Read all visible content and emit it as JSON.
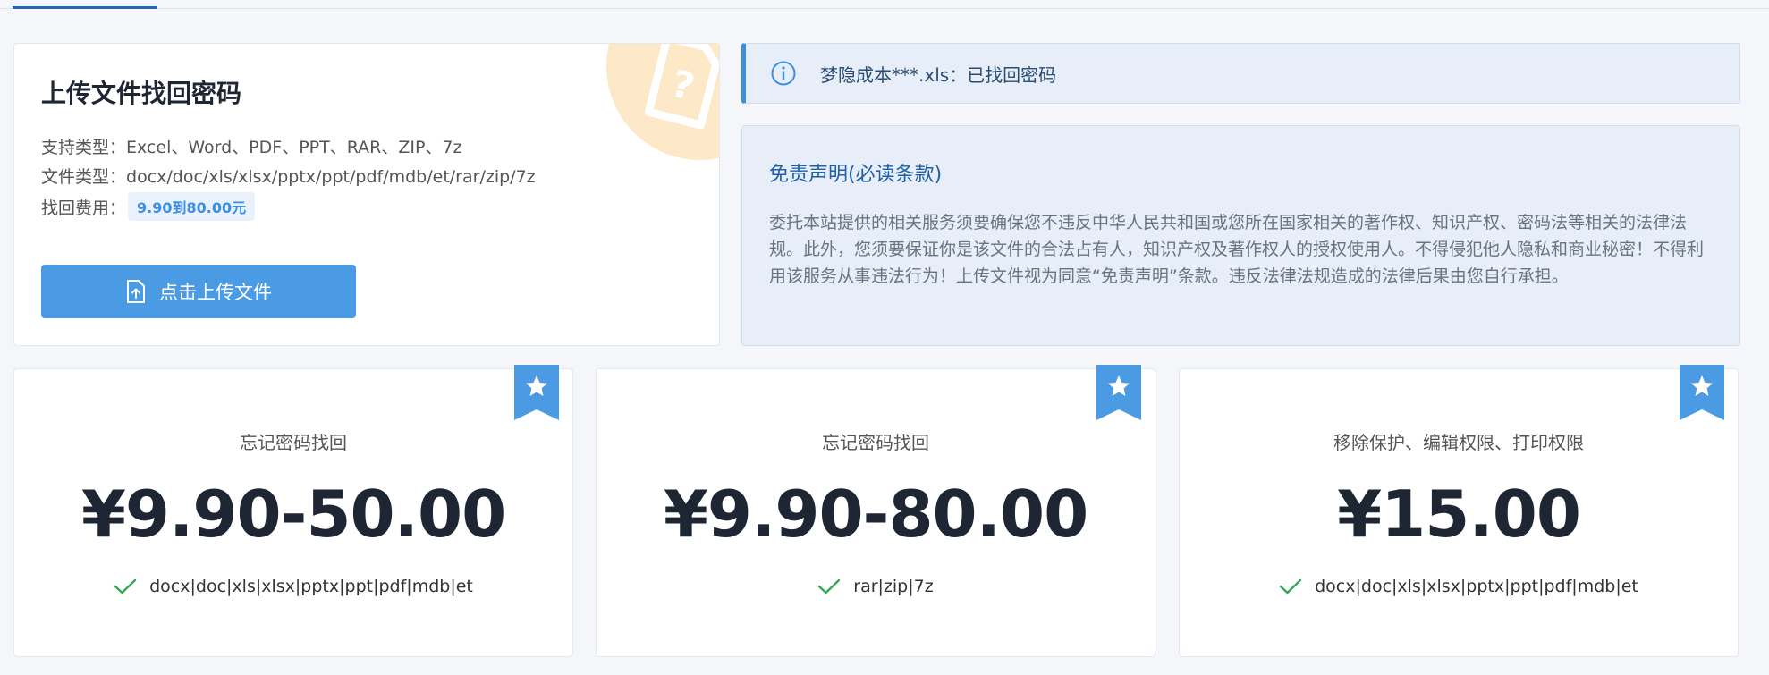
{
  "upload": {
    "title": "上传文件找回密码",
    "support_label": "支持类型：",
    "support_value": "Excel、Word、PDF、PPT、RAR、ZIP、7z",
    "filetype_label": "文件类型：",
    "filetype_value": "docx/doc/xls/xlsx/pptx/ppt/pdf/mdb/et/rar/zip/7z",
    "fee_label": "找回费用：",
    "fee_value": "9.90到80.00元",
    "button_label": "点击上传文件",
    "button_icon": "file-upload-icon",
    "decor_icon": "file-question-icon"
  },
  "notice": {
    "icon": "info-icon",
    "text": "梦隐成本***.xls：已找回密码"
  },
  "disclaimer": {
    "title": "免责声明(必读条款)",
    "body": "委托本站提供的相关服务须要确保您不违反中华人民共和国或您所在国家相关的著作权、知识产权、密码法等相关的法律法规。此外，您须要保证你是该文件的合法占有人，知识产权及著作权人的授权使用人。不得侵犯他人隐私和商业秘密！不得利用该服务从事违法行为！上传文件视为同意“免责声明”条款。违反法律法规造成的法律后果由您自行承担。"
  },
  "plans": [
    {
      "subtitle": "忘记密码找回",
      "price": "¥9.90-50.00",
      "feature": "docx|doc|xls|xlsx|pptx|ppt|pdf|mdb|et",
      "badge_icon": "star-ribbon-icon",
      "feature_icon": "check-icon"
    },
    {
      "subtitle": "忘记密码找回",
      "price": "¥9.90-80.00",
      "feature": "rar|zip|7z",
      "badge_icon": "star-ribbon-icon",
      "feature_icon": "check-icon"
    },
    {
      "subtitle": "移除保护、编辑权限、打印权限",
      "price": "¥15.00",
      "feature": "docx|doc|xls|xlsx|pptx|ppt|pdf|mdb|et",
      "badge_icon": "star-ribbon-icon",
      "feature_icon": "check-icon"
    }
  ],
  "colors": {
    "accent": "#4b9be4",
    "title_blue": "#1f5fa8",
    "ribbon": "#4b9be4",
    "check": "#34a853",
    "decor": "#fde8c7"
  }
}
